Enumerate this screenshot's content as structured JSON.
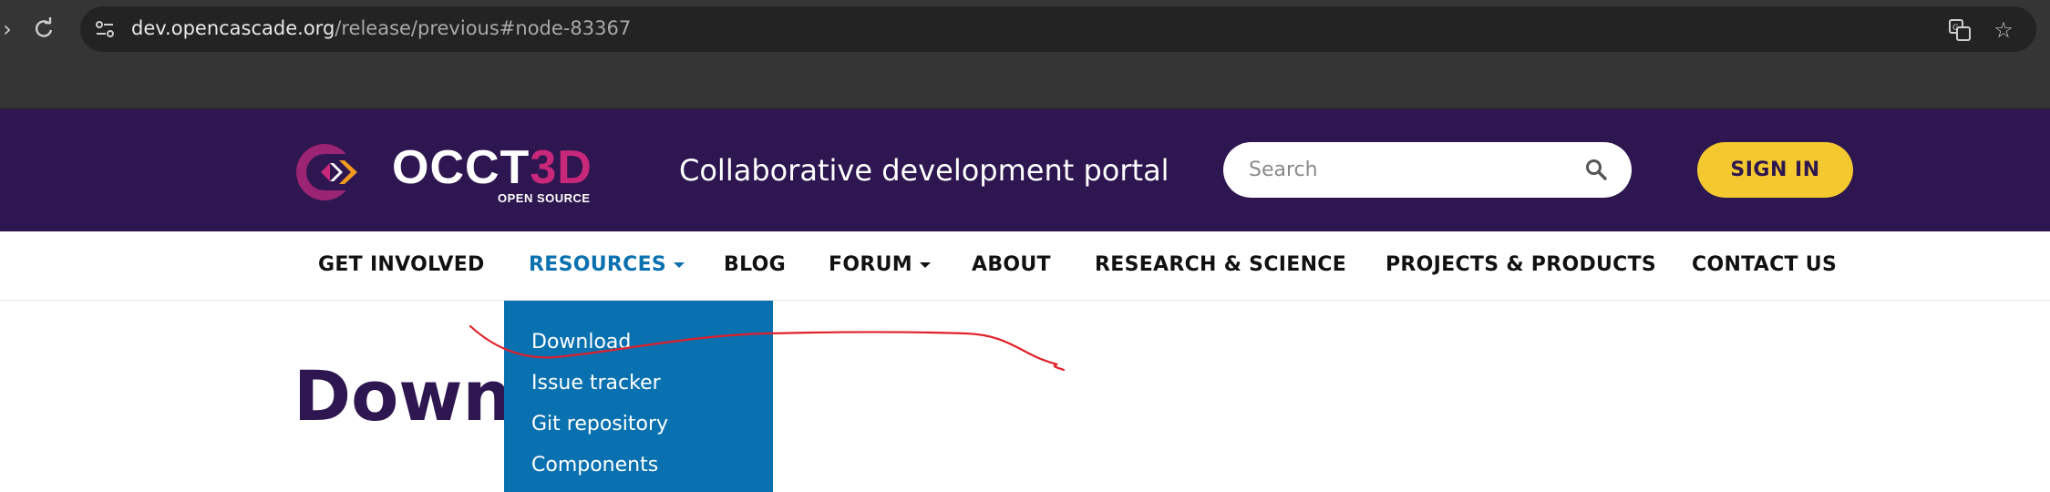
{
  "browser": {
    "url_host": "dev.opencascade.org",
    "url_path": "/release/previous#node-83367"
  },
  "header": {
    "logo_text": "OCCT",
    "logo_text_accent": "3D",
    "logo_subtext": "OPEN SOURCE",
    "tagline": "Collaborative development portal",
    "search_placeholder": "Search",
    "signin_label": "SIGN IN"
  },
  "nav": {
    "items": [
      {
        "label": "GET INVOLVED"
      },
      {
        "label": "RESOURCES"
      },
      {
        "label": "BLOG"
      },
      {
        "label": "FORUM"
      },
      {
        "label": "ABOUT"
      },
      {
        "label": "RESEARCH & SCIENCE"
      },
      {
        "label": "PROJECTS & PRODUCTS"
      },
      {
        "label": "CONTACT US"
      }
    ]
  },
  "dropdown": {
    "items": [
      {
        "label": "Download"
      },
      {
        "label": "Issue tracker"
      },
      {
        "label": "Git repository"
      },
      {
        "label": "Components"
      }
    ]
  },
  "page": {
    "title": "Down"
  },
  "colors": {
    "header_bg": "#2e1650",
    "accent_blue": "#0a71b0",
    "signin_yellow": "#f4c92f",
    "annotation_red": "#e0202a"
  }
}
